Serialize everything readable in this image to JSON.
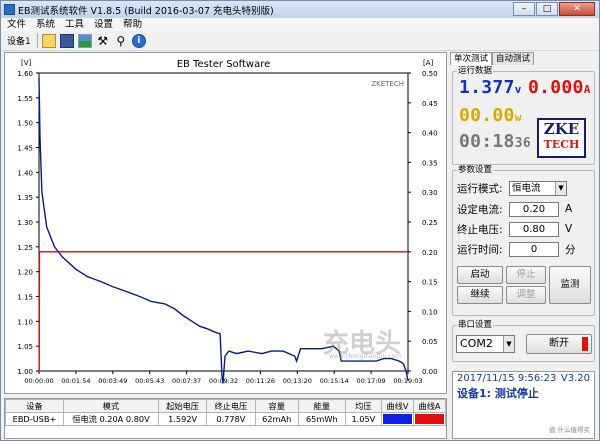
{
  "window": {
    "title": "EB测试系统软件 V1.8.5 (Build 2016-03-07 充电头特别版)",
    "minimize": "–",
    "maximize": "□",
    "close": "✕"
  },
  "menu": [
    "文件",
    "系统",
    "工具",
    "设置",
    "帮助"
  ],
  "toolbar": {
    "device_label": "设备1",
    "icons": [
      "folder-open-icon",
      "save-icon",
      "chart-icon",
      "tools-icon",
      "search-icon",
      "info-icon"
    ]
  },
  "chart_data": {
    "type": "line",
    "title": "EB Tester Software",
    "watermark_brand": "ZKETECH",
    "left_unit": "[V]",
    "right_unit": "[A]",
    "ylim_left": [
      1.0,
      1.6
    ],
    "ylim_right": [
      0.0,
      0.5
    ],
    "yticks_left": [
      "1.60",
      "1.55",
      "1.50",
      "1.45",
      "1.40",
      "1.35",
      "1.30",
      "1.25",
      "1.20",
      "1.15",
      "1.10",
      "1.05",
      "1.00"
    ],
    "yticks_right": [
      "0.50",
      "0.45",
      "0.40",
      "0.35",
      "0.30",
      "0.25",
      "0.20",
      "0.15",
      "0.10",
      "0.05",
      "0.00"
    ],
    "xticks": [
      "00:00:00",
      "00:01:54",
      "00:03:49",
      "00:05:43",
      "00:07:37",
      "00:09:32",
      "00:11:26",
      "00:13:20",
      "00:15:14",
      "00:17:09",
      "00:19:03"
    ],
    "x_minutes_max": 19.05,
    "series": [
      {
        "color": "#0a1a8c",
        "axis": "left",
        "x": [
          0,
          0.05,
          0.15,
          0.4,
          0.8,
          1.2,
          1.9,
          2.5,
          3.2,
          3.8,
          4.5,
          5.2,
          5.8,
          6.5,
          7.0,
          7.5,
          7.9,
          8.3,
          8.7,
          9.1,
          9.35,
          9.45,
          9.5,
          9.6,
          9.8,
          10.2,
          10.8,
          11.5,
          12.0,
          12.6,
          13.2,
          13.3,
          13.5,
          14.0,
          14.6,
          15.2,
          15.5,
          15.6,
          15.9,
          16.4,
          16.9,
          17.4,
          17.8,
          18.2,
          18.6,
          18.8,
          18.95,
          19.05
        ],
        "y": [
          1.59,
          1.47,
          1.36,
          1.29,
          1.25,
          1.23,
          1.205,
          1.19,
          1.18,
          1.17,
          1.16,
          1.15,
          1.14,
          1.135,
          1.125,
          1.11,
          1.1,
          1.09,
          1.085,
          1.078,
          1.075,
          0.99,
          0.975,
          1.03,
          1.04,
          1.035,
          1.04,
          1.035,
          1.04,
          1.04,
          1.03,
          1.02,
          1.045,
          1.045,
          1.045,
          1.05,
          1.04,
          1.02,
          1.02,
          1.02,
          1.02,
          1.02,
          1.025,
          1.025,
          1.02,
          1.015,
          1.0,
          0.98
        ]
      },
      {
        "color": "#c81010",
        "axis": "right",
        "x": [
          0,
          0.01,
          0.02,
          19.05
        ],
        "y": [
          0.0,
          0.0,
          0.2,
          0.2
        ]
      }
    ]
  },
  "table": {
    "headers": [
      "设备",
      "模式",
      "起始电压",
      "终止电压",
      "容量",
      "能量",
      "均压",
      "曲线V",
      "曲线A"
    ],
    "rows": [
      [
        "EBD-USB+",
        "恒电流 0.20A 0.80V",
        "1.592V",
        "0.778V",
        "62mAh",
        "65mWh",
        "1.05V",
        "",
        ""
      ]
    ],
    "curve_v_color": "#1020e0",
    "curve_a_color": "#e01010"
  },
  "tabs": [
    "单次测试",
    "自动测试"
  ],
  "realtime": {
    "title": "运行数据",
    "voltage": "1.377",
    "voltage_unit": "v",
    "current": "0.000",
    "current_unit": "A",
    "power": "00.00",
    "power_unit": "w",
    "time": "00:18",
    "time_sec": "36",
    "logo_top": "ZKE",
    "logo_bottom": "TECH"
  },
  "params": {
    "title": "参数设置",
    "mode_label": "运行模式:",
    "mode_value": "恒电流",
    "current_label": "设定电流:",
    "current_value": "0.20",
    "current_unit": "A",
    "cutoff_label": "终止电压:",
    "cutoff_value": "0.80",
    "cutoff_unit": "V",
    "runtime_label": "运行时间:",
    "runtime_value": "0",
    "runtime_unit": "分",
    "start_btn": "启动",
    "stop_btn": "停止",
    "continue_btn": "继续",
    "adjust_btn": "调整",
    "monitor_btn": "监测"
  },
  "port": {
    "title": "串口设置",
    "value": "COM2",
    "disconnect_btn": "断开"
  },
  "status": {
    "datetime": "2017/11/15 9:56:23",
    "version": "V3.20",
    "message": "设备1: 测试停止"
  },
  "watermark": {
    "text": "充电头",
    "url": "www.chongdiantou.com",
    "corner": "值 什么值得买"
  }
}
